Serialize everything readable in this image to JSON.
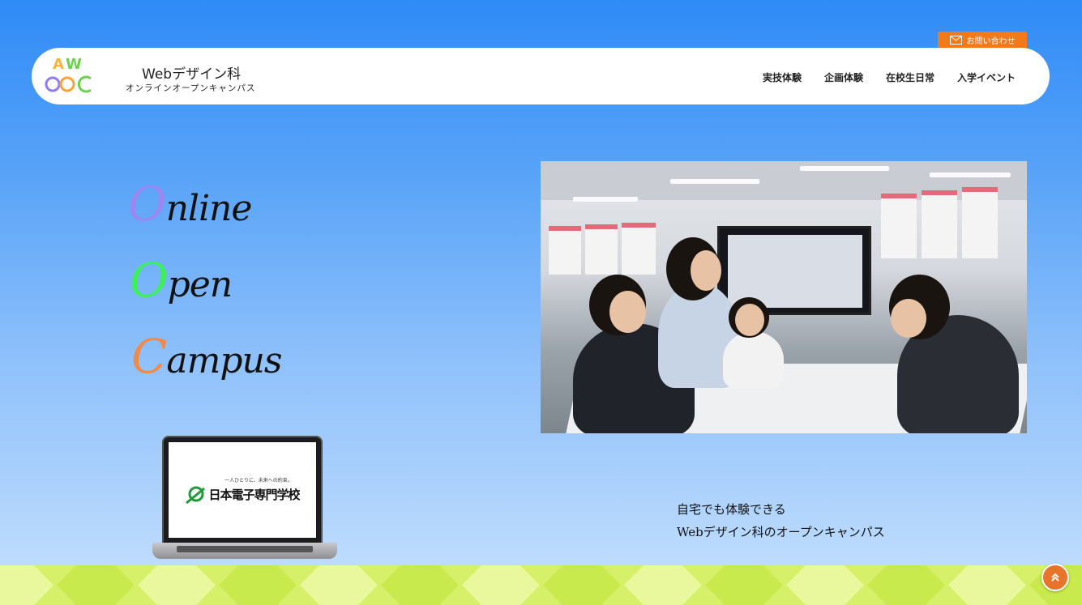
{
  "contact": {
    "label": "お問い合わせ",
    "icon": "mail-icon"
  },
  "header": {
    "title": "Webデザイン科",
    "subtitle": "オンラインオープンキャンパス",
    "logo": {
      "text": "AWOOC",
      "colors": [
        "#f7a23b",
        "#6ad24c",
        "#8f7af0",
        "#3cc6e8",
        "#f5d63a"
      ]
    }
  },
  "nav": {
    "items": [
      {
        "label": "実技体験"
      },
      {
        "label": "企画体験"
      },
      {
        "label": "在校生日常"
      },
      {
        "label": "入学イベント"
      }
    ]
  },
  "hero": {
    "words": [
      {
        "cap": "O",
        "rest": "nline",
        "color": "#9e86f0"
      },
      {
        "cap": "O",
        "rest": "pen",
        "color": "#3df05a"
      },
      {
        "cap": "C",
        "rest": "ampus",
        "color": "#f08a4a"
      }
    ]
  },
  "laptop": {
    "tagline": "一人ひとりに、未来への約束。",
    "school": "日本電子専門学校"
  },
  "tagline": {
    "line1": "自宅でも体験できる",
    "line2": "Webデザイン科のオープンキャンパス"
  },
  "scroll_top": {
    "icon": "chevron-double-up-icon"
  },
  "colors": {
    "accent_orange": "#f27a1a",
    "band": "#d7f06a",
    "background_top": "#2f8bf7"
  }
}
